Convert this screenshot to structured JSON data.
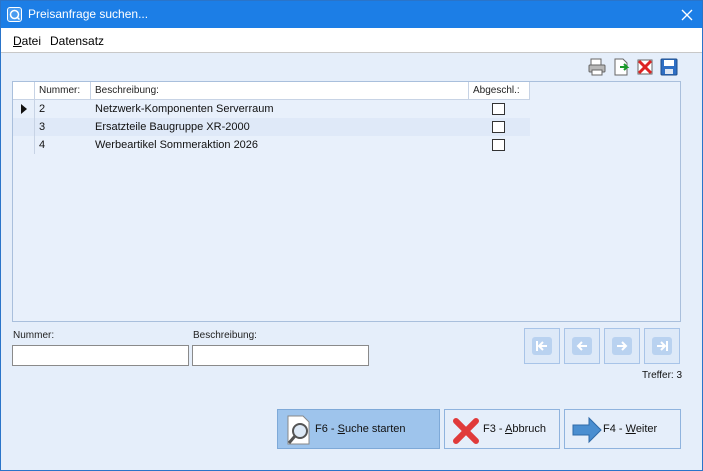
{
  "window": {
    "title": "Preisanfrage suchen..."
  },
  "menu": [
    {
      "label": "Datei",
      "accel": "D",
      "rest": "atei"
    },
    {
      "label": "Datensatz"
    }
  ],
  "grid": {
    "columns": [
      "Nummer:",
      "Beschreibung:",
      "Abgeschl.:"
    ],
    "rows": [
      {
        "nummer": "2",
        "beschreibung": "Netzwerk-Komponenten Serverraum",
        "abgeschlossen": false,
        "current": true
      },
      {
        "nummer": "3",
        "beschreibung": "Ersatzteile Baugruppe XR-2000",
        "abgeschlossen": false,
        "current": false
      },
      {
        "nummer": "4",
        "beschreibung": "Werbeartikel Sommeraktion 2026",
        "abgeschlossen": false,
        "current": false
      }
    ]
  },
  "filters": {
    "nummer_label": "Nummer:",
    "nummer_value": "",
    "beschreibung_label": "Beschreibung:",
    "beschreibung_value": ""
  },
  "toolbar_icons": [
    "printer-icon",
    "export-icon",
    "delete-icon",
    "save-icon"
  ],
  "nav_icons": [
    "first-record-icon",
    "previous-record-icon",
    "next-record-icon",
    "last-record-icon"
  ],
  "status": {
    "treffer": "Treffer: 3"
  },
  "buttons": {
    "search": {
      "pre": "F6 - ",
      "accel": "S",
      "post": "uche starten"
    },
    "cancel": {
      "pre": "F3 - ",
      "accel": "A",
      "post": "bbruch"
    },
    "next": {
      "pre": "F4 - ",
      "accel": "W",
      "post": "eiter"
    }
  },
  "colors": {
    "titlebar": "#1c7ee6",
    "client": "#e5eefa",
    "primary_button": "#9ec4ec"
  }
}
